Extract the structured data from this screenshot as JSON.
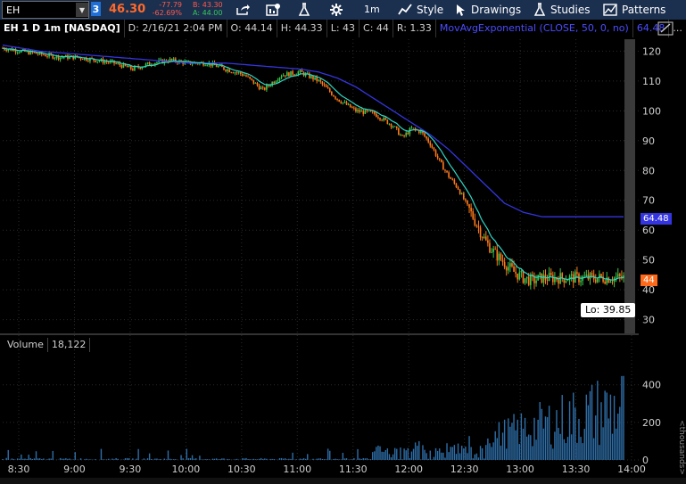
{
  "toolbar": {
    "symbol": "EH",
    "link_number": "3",
    "last_price": "46.30",
    "net_change": "-77.79",
    "pct_change": "-62.69%",
    "bid": "B: 43.30",
    "ask": "A: 44.00",
    "timeframe": "1m",
    "style": "Style",
    "drawings": "Drawings",
    "studies": "Studies",
    "patterns": "Patterns"
  },
  "header": {
    "title": "EH 1 D 1m [NASDAQ]",
    "date": "D: 2/16/21 2:04 PM",
    "open": "O: 44.14",
    "high": "H: 44.33",
    "low": "L: 43",
    "close": "C: 44",
    "range": "R: 1.33",
    "study": "MovAvgExponential (CLOSE, 50, 0, no)",
    "study_value": "64.48",
    "more": "..."
  },
  "volume": {
    "label": "Volume",
    "value": "18,122"
  },
  "lo_label": "Lo: 39.85",
  "colors": {
    "up": "#3ec84d",
    "down": "#ff7a1a",
    "ema50": "#3434e0",
    "ema_fast": "#2fd6c4",
    "volume": "#2e6ea8",
    "grid": "#2a2a2a"
  },
  "chart_data": {
    "type": "line",
    "price_axis": {
      "ticks": [
        120,
        110,
        100,
        90,
        80,
        70,
        60,
        50,
        40,
        30
      ],
      "ylim": [
        26,
        124
      ]
    },
    "volume_axis": {
      "ticks": [
        400,
        200,
        0
      ],
      "ylim": [
        0,
        560
      ],
      "unit_label": "<thousands>"
    },
    "x_ticks": [
      "8:30",
      "9:00",
      "9:30",
      "10:00",
      "10:30",
      "11:00",
      "11:30",
      "12:00",
      "12:30",
      "13:00",
      "13:30",
      "14:00"
    ],
    "series": [
      {
        "name": "Price",
        "x": [
          0,
          10,
          20,
          30,
          40,
          50,
          60,
          70,
          80,
          90,
          100,
          110,
          120,
          130,
          140,
          150,
          160,
          170,
          180,
          190,
          200,
          210,
          215,
          220,
          225,
          230,
          235,
          240,
          245,
          250,
          255,
          260,
          265,
          270,
          275,
          280,
          285,
          290,
          295,
          300,
          305,
          310,
          314,
          318,
          322,
          326,
          330,
          334
        ],
        "values": [
          121,
          120,
          119,
          118,
          118,
          117,
          116,
          114,
          116,
          117,
          116,
          116,
          114,
          112,
          107,
          112,
          113,
          110,
          104,
          100,
          99,
          95,
          91,
          94,
          93,
          89,
          83,
          78,
          74,
          68,
          62,
          56,
          52,
          49,
          46,
          44,
          43,
          44,
          44,
          44,
          44,
          44,
          44,
          44,
          44,
          44,
          44,
          44
        ]
      },
      {
        "name": "MovAvgExponential",
        "x": [
          0,
          20,
          40,
          60,
          80,
          100,
          120,
          140,
          160,
          170,
          180,
          190,
          200,
          210,
          220,
          230,
          240,
          250,
          260,
          270,
          280,
          290,
          298,
          306,
          314,
          322,
          330,
          334
        ],
        "values": [
          122,
          120,
          119,
          118,
          117,
          116,
          116,
          115,
          114,
          113,
          111,
          108,
          104,
          100,
          96,
          92,
          87,
          81,
          75,
          69,
          66,
          64.5,
          64.48,
          64.48,
          64.48,
          64.48,
          64.48,
          64.48
        ]
      }
    ]
  }
}
